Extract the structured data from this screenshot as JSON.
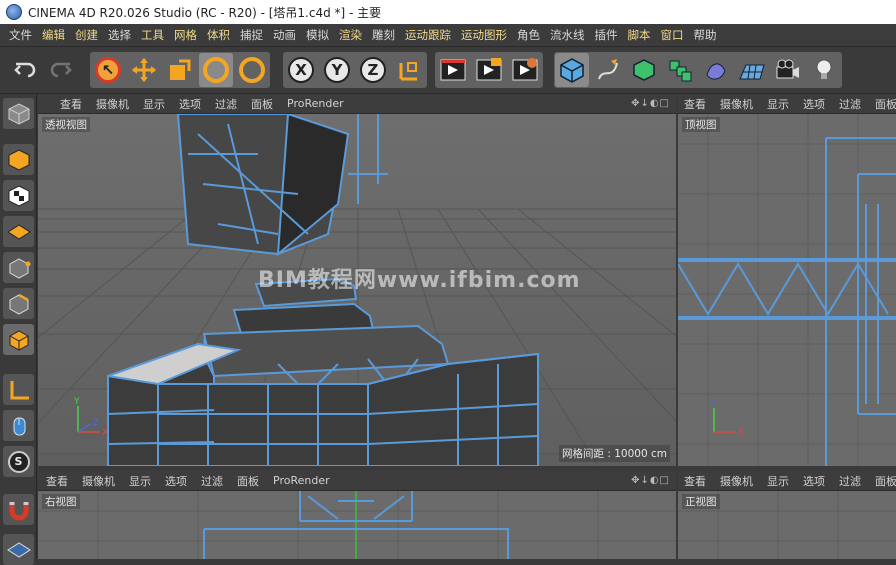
{
  "window": {
    "title": "CINEMA 4D R20.026 Studio (RC - R20) - [塔吊1.c4d *] - 主要"
  },
  "menu": {
    "items": [
      "文件",
      "编辑",
      "创建",
      "选择",
      "工具",
      "网格",
      "体积",
      "捕捉",
      "动画",
      "模拟",
      "渲染",
      "雕刻",
      "运动跟踪",
      "运动图形",
      "角色",
      "流水线",
      "插件",
      "脚本",
      "窗口",
      "帮助"
    ]
  },
  "toolbar": {
    "icons": [
      "undo-icon",
      "redo-icon",
      "live-select-icon",
      "move-icon",
      "scale-icon",
      "rotate-icon",
      "recent-tool-icon",
      "x-axis-icon",
      "y-axis-icon",
      "z-axis-icon",
      "coordinate-system-icon",
      "render-view-icon",
      "render-picture-viewer-icon",
      "render-settings-icon",
      "cube-object-icon",
      "pen-spline-icon",
      "subdivision-icon",
      "array-icon",
      "deformer-icon",
      "floor-icon",
      "camera-icon",
      "light-icon"
    ],
    "axis_labels": [
      "X",
      "Y",
      "Z"
    ]
  },
  "viewport_menu": {
    "items": [
      "查看",
      "摄像机",
      "显示",
      "选项",
      "过滤",
      "面板",
      "ProRender"
    ]
  },
  "viewports": {
    "perspective": {
      "label": "透视视图",
      "grid_info": "网格间距 : 10000 cm"
    },
    "top": {
      "label": "顶视图"
    },
    "right": {
      "label": "右视图"
    },
    "front": {
      "label": "正视图"
    }
  },
  "axis": {
    "x": "X",
    "y": "Y",
    "z": "Z"
  },
  "watermark": "BIM教程网www.ifbim.com",
  "colors": {
    "wire": "#5a9ad8",
    "accent_menu": "#f0d98a",
    "bg_viewport": "#6b6b6b"
  }
}
